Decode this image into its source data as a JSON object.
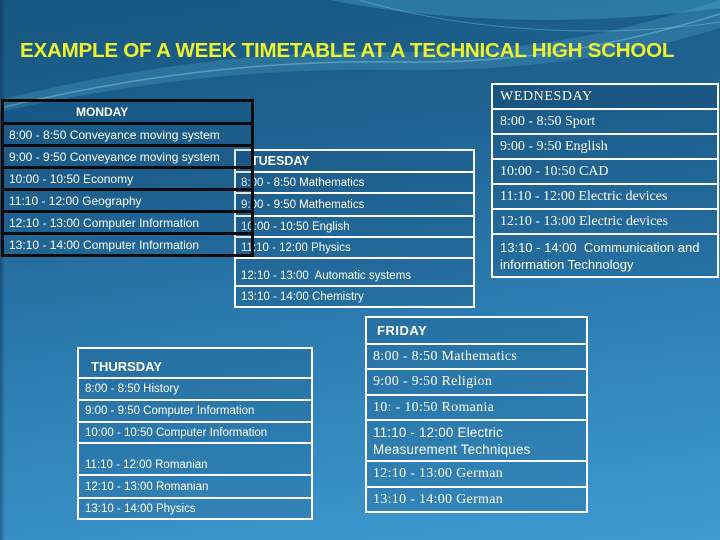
{
  "title": "EXAMPLE OF A WEEK TIMETABLE AT A TECHNICAL HIGH SCHOOL",
  "colors": {
    "title": "#eef52c",
    "background_top": "#175680",
    "background_bottom": "#3f9bd2",
    "monday_border": "#0a0a0a",
    "box_border": "#ffffff",
    "text": "#ffffff"
  },
  "days": {
    "monday": {
      "name": "MONDAY",
      "slots": [
        "8:00 - 8:50 Conveyance moving system",
        "9:00 - 9:50 Conveyance moving system",
        "10:00 - 10:50 Economy",
        "11:10 - 12:00 Geography",
        "12:10 - 13:00 Computer Information",
        "13:10 - 14:00 Computer Information"
      ]
    },
    "tuesday": {
      "name": "TUESDAY",
      "slots": [
        "8:00 - 8:50 Mathematics",
        "9:00 - 9:50 Mathematics",
        "10:00 - 10:50 English",
        "11:10 - 12:00 Physics",
        "12:10 - 13:00  Automatic systems",
        "13:10 - 14:00 Chemistry"
      ]
    },
    "wednesday": {
      "name": "WEDNESDAY",
      "slots": [
        "8:00 - 8:50 Sport",
        "9:00 - 9:50 English",
        "10:00 - 10:50 CAD",
        "11:10 - 12:00 Electric devices",
        "12:10 - 13:00 Electric devices",
        "13:10 - 14:00  Communication and information Technology"
      ]
    },
    "thursday": {
      "name": "THURSDAY",
      "slots": [
        "8:00 - 8:50 History",
        "9:00 - 9:50 Computer Information",
        "10:00 - 10:50 Computer Information",
        "11:10 - 12:00 Romanian",
        "12:10 - 13:00 Romanian",
        "13:10 - 14:00 Physics"
      ]
    },
    "friday": {
      "name": "FRIDAY",
      "slots": [
        "8:00 - 8:50 Mathematics",
        "9:00 - 9:50 Religion",
        "10: - 10:50 Romania",
        "11:10 - 12:00 Electric Measurement Techniques",
        "12:10 - 13:00 German",
        "13:10 - 14:00 German"
      ]
    }
  }
}
